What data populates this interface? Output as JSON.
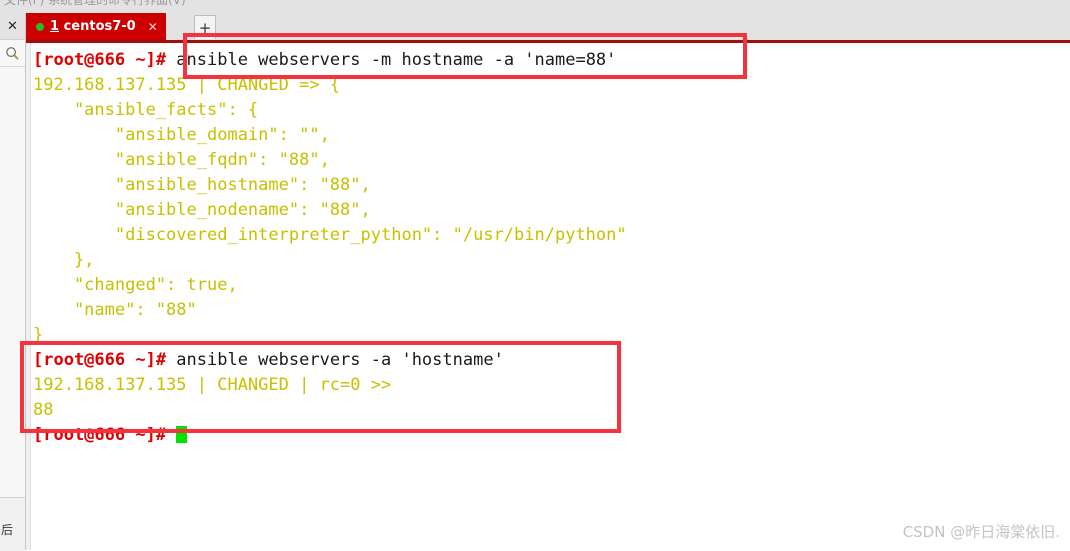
{
  "window": {
    "top_strip_text": "文件(F) 系统管理的命令行界面(V)",
    "bottom_rail_text": "后"
  },
  "left_rail": {
    "close_icon": "close-icon",
    "close_glyph": "✕",
    "search_icon": "search-icon"
  },
  "tabbar": {
    "tab": {
      "status_dot": "connected-dot",
      "index": "1",
      "label": " centos7-0",
      "close_glyph": "✕"
    },
    "add_tab_glyph": "+"
  },
  "terminal": {
    "lines": [
      {
        "prompt": "[root@666 ~]#",
        "command": " ansible webservers -m hostname -a 'name=88'"
      },
      {
        "output": "192.168.137.135 | CHANGED => {"
      },
      {
        "output": "    \"ansible_facts\": {"
      },
      {
        "output": "        \"ansible_domain\": \"\","
      },
      {
        "output": "        \"ansible_fqdn\": \"88\","
      },
      {
        "output": "        \"ansible_hostname\": \"88\","
      },
      {
        "output": "        \"ansible_nodename\": \"88\","
      },
      {
        "output": "        \"discovered_interpreter_python\": \"/usr/bin/python\""
      },
      {
        "output": "    },"
      },
      {
        "output": "    \"changed\": true,"
      },
      {
        "output": "    \"name\": \"88\""
      },
      {
        "output": "}"
      },
      {
        "prompt": "[root@666 ~]#",
        "command": " ansible webservers -a 'hostname'"
      },
      {
        "output": "192.168.137.135 | CHANGED | rc=0 >>"
      },
      {
        "output": "88"
      },
      {
        "prompt": "[root@666 ~]#",
        "command": " ",
        "cursor": true
      }
    ]
  },
  "annotations": [
    {
      "name": "highlight-box-command-1"
    },
    {
      "name": "highlight-box-command-2"
    }
  ],
  "watermark": {
    "text": "CSDN @昨日海棠依旧."
  },
  "colors": {
    "tab_active": "#cc0000",
    "tab_bar_border": "#9e1010",
    "prompt": "#e00000",
    "output": "#c8c000",
    "command": "#1a1a1a",
    "annotation": "#f4333d",
    "cursor": "#00e400"
  }
}
